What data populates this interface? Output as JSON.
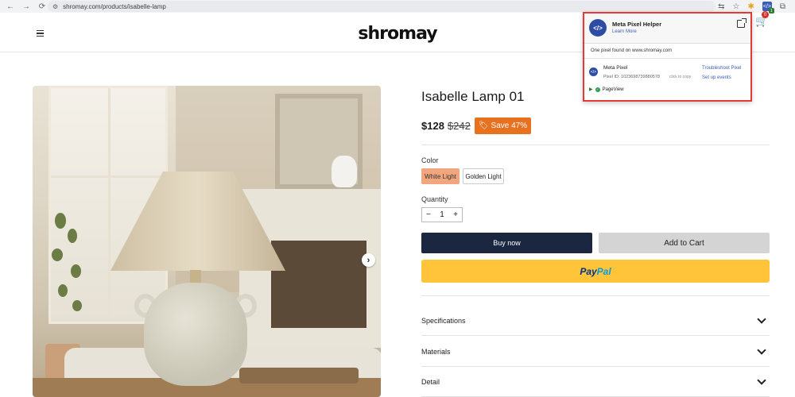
{
  "browser": {
    "back_glyph": "←",
    "forward_glyph": "→",
    "reload_glyph": "⟳",
    "url": "shromay.com/products/isabelle-lamp"
  },
  "header": {
    "logo": "shromay",
    "cart_count": "0"
  },
  "product": {
    "title": "Isabelle Lamp 01",
    "price": "$128",
    "compare_price": "$242",
    "sale_badge": "Save 47%",
    "color_label": "Color",
    "colors": [
      "White Light",
      "Golden Light"
    ],
    "selected_color": "White Light",
    "quantity_label": "Quantity",
    "quantity": "1",
    "buy_now": "Buy now",
    "add_to_cart": "Add to Cart",
    "paypal_part1": "Pay",
    "paypal_part2": "Pal",
    "accordions": [
      "Specifications",
      "Materials",
      "Detail"
    ]
  },
  "pixel_helper": {
    "title": "Meta Pixel Helper",
    "learn_more": "Learn More",
    "found_text": "One pixel found on www.shromay.com",
    "pixel_name": "Meta Pixel",
    "pixel_id": "Pixel ID: 1023698739880578",
    "click_to_copy": "click to copy",
    "troubleshoot": "Troubleshoot Pixel",
    "setup_events": "Set up events",
    "event": "PageView"
  },
  "colors": {
    "buy_now_bg": "#1b2640",
    "sale_badge_bg": "#e8711f",
    "paypal_bg": "#ffc439",
    "selected_swatch_bg": "#f2a67e",
    "popup_border": "#e53935"
  }
}
